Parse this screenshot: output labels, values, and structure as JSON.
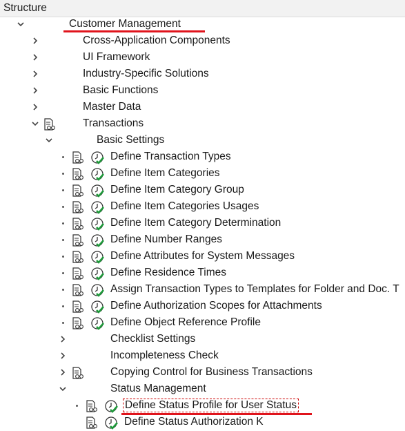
{
  "header": {
    "title": "Structure"
  },
  "tree": {
    "customer_management": "Customer Management",
    "cross_app": "Cross-Application Components",
    "ui_framework": "UI Framework",
    "industry": "Industry-Specific Solutions",
    "basic_functions": "Basic Functions",
    "master_data": "Master Data",
    "transactions": "Transactions",
    "basic_settings": "Basic Settings",
    "items": [
      "Define Transaction Types",
      "Define Item Categories",
      "Define Item Category Group",
      "Define Item Categories Usages",
      "Define Item Category Determination",
      "Define Number Ranges",
      "Define Attributes for System Messages",
      "Define Residence Times",
      "Assign Transaction Types to Templates for Folder and Doc. T",
      "Define Authorization Scopes for Attachments",
      "Define Object Reference Profile"
    ],
    "checklist": "Checklist Settings",
    "incompleteness": "Incompleteness Check",
    "copying_control": "Copying Control for Business Transactions",
    "status_management": "Status Management",
    "status_profile": "Define Status Profile for User Status",
    "status_auth": "Define Status Authorization K"
  }
}
